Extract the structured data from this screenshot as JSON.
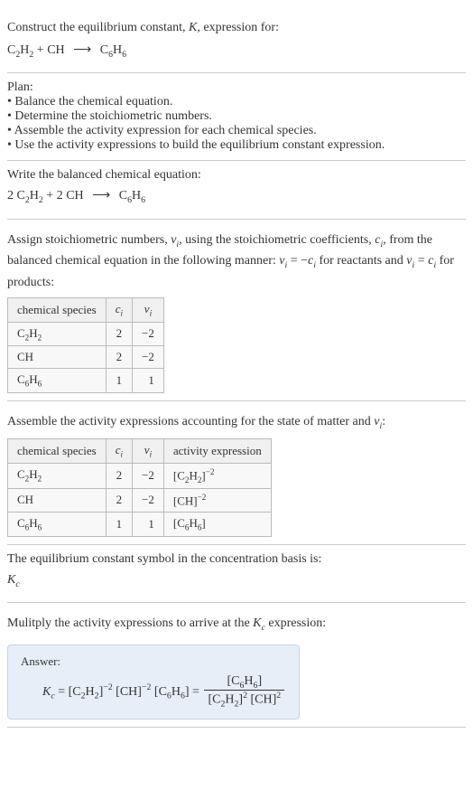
{
  "intro": {
    "construct_text": "Construct the equilibrium constant, ",
    "K": "K",
    "expression_for": ", expression for:"
  },
  "reaction": {
    "r1": "C",
    "r1s1": "2",
    "r1b": "H",
    "r1s2": "2",
    "plus": " + ",
    "r2": "CH",
    "arrow": "⟶",
    "p1": "C",
    "p1s1": "6",
    "p1b": "H",
    "p1s2": "6"
  },
  "plan": {
    "label": "Plan:",
    "item1": "Balance the chemical equation.",
    "item2": "Determine the stoichiometric numbers.",
    "item3": "Assemble the activity expression for each chemical species.",
    "item4": "Use the activity expressions to build the equilibrium constant expression."
  },
  "balanced": {
    "intro": "Write the balanced chemical equation:",
    "coef1": "2 ",
    "coef2": "2 "
  },
  "stoich": {
    "text1": "Assign stoichiometric numbers, ",
    "nu": "ν",
    "sub_i": "i",
    "text2": ", using the stoichiometric coefficients, ",
    "c": "c",
    "text3": ", from the balanced chemical equation in the following manner: ",
    "eq_react": " = −",
    "text4": " for reactants and ",
    "eq_prod": " = ",
    "text5": " for products:"
  },
  "table1": {
    "h1": "chemical species",
    "r1": {
      "c": "2",
      "nu": "−2"
    },
    "r2": {
      "sp": "CH",
      "c": "2",
      "nu": "−2"
    },
    "r3": {
      "c": "1",
      "nu": "1"
    }
  },
  "activity": {
    "intro": "Assemble the activity expressions accounting for the state of matter and ",
    "colon": ":"
  },
  "table2": {
    "h4": "activity expression",
    "r1": {
      "c": "2",
      "nu": "−2",
      "exp": "−2"
    },
    "r2": {
      "c": "2",
      "nu": "−2",
      "exp": "−2"
    },
    "r3": {
      "c": "1",
      "nu": "1"
    }
  },
  "symbol": {
    "text": "The equilibrium constant symbol in the concentration basis is:",
    "Kc_K": "K",
    "Kc_c": "c"
  },
  "multiply": {
    "text1": "Mulitply the activity expressions to arrive at the ",
    "text2": " expression:"
  },
  "answer": {
    "label": "Answer:",
    "eq": " = ",
    "exp_n2": "−2",
    "exp_2": "2"
  },
  "chart_data": {
    "type": "table",
    "tables": [
      {
        "columns": [
          "chemical species",
          "c_i",
          "ν_i"
        ],
        "rows": [
          [
            "C2H2",
            2,
            -2
          ],
          [
            "CH",
            2,
            -2
          ],
          [
            "C6H6",
            1,
            1
          ]
        ]
      },
      {
        "columns": [
          "chemical species",
          "c_i",
          "ν_i",
          "activity expression"
        ],
        "rows": [
          [
            "C2H2",
            2,
            -2,
            "[C2H2]^-2"
          ],
          [
            "CH",
            2,
            -2,
            "[CH]^-2"
          ],
          [
            "C6H6",
            1,
            1,
            "[C6H6]"
          ]
        ]
      }
    ]
  }
}
